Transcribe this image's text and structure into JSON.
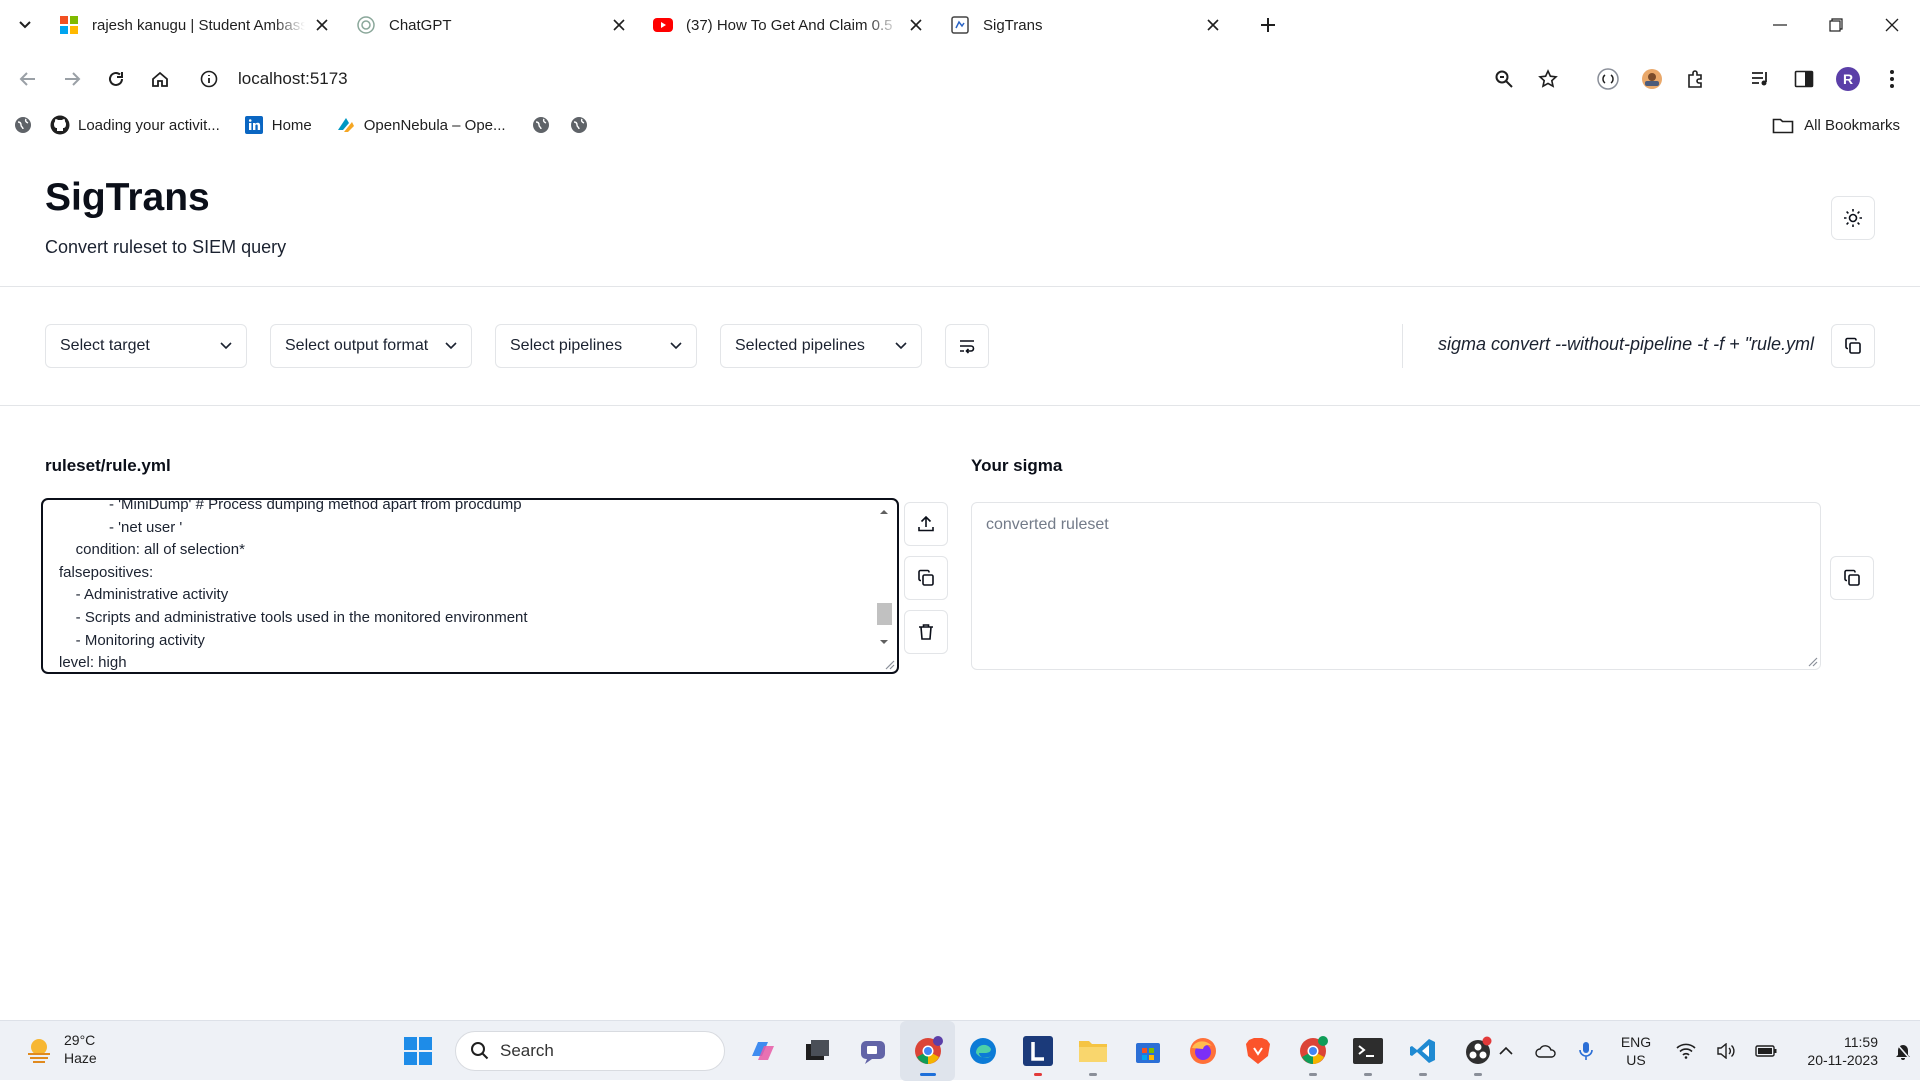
{
  "browser": {
    "tabs": [
      {
        "title": "rajesh kanugu | Student Ambassador",
        "icon": "microsoft-logo-icon"
      },
      {
        "title": "ChatGPT",
        "icon": "chatgpt-icon"
      },
      {
        "title": "(37) How To Get And Claim 0.5",
        "icon": "youtube-icon"
      },
      {
        "title": "SigTrans",
        "icon": "sigtrans-favicon"
      }
    ],
    "url": "localhost:5173",
    "avatar_letter": "R",
    "bookmarks": [
      {
        "label": "Loading your activit...",
        "icon": "github-icon"
      },
      {
        "label": "Home",
        "icon": "linkedin-icon"
      },
      {
        "label": "OpenNebula – Ope...",
        "icon": "opennebula-icon"
      }
    ],
    "all_bookmarks": "All Bookmarks"
  },
  "app": {
    "title": "SigTrans",
    "subtitle": "Convert ruleset to SIEM query"
  },
  "controls": {
    "target": "Select target",
    "output_format": "Select output format",
    "pipelines": "Select pipelines",
    "selected_pipelines": "Selected pipelines",
    "command": "sigma convert --without-pipeline -t -f + \"rule.yml"
  },
  "editor": {
    "label": "ruleset/rule.yml",
    "lines": [
      "            - 'MiniDump' # Process dumping method apart from procdump",
      "            - 'net user '",
      "    condition: all of selection*",
      "falsepositives:",
      "    - Administrative activity",
      "    - Scripts and administrative tools used in the monitored environment",
      "    - Monitoring activity",
      "level: high"
    ]
  },
  "output": {
    "label": "Your sigma",
    "placeholder": "converted ruleset"
  },
  "taskbar": {
    "temperature": "29°C",
    "weather": "Haze",
    "search": "Search",
    "lang_1": "ENG",
    "lang_2": "US",
    "time": "11:59",
    "date": "20-11-2023"
  }
}
